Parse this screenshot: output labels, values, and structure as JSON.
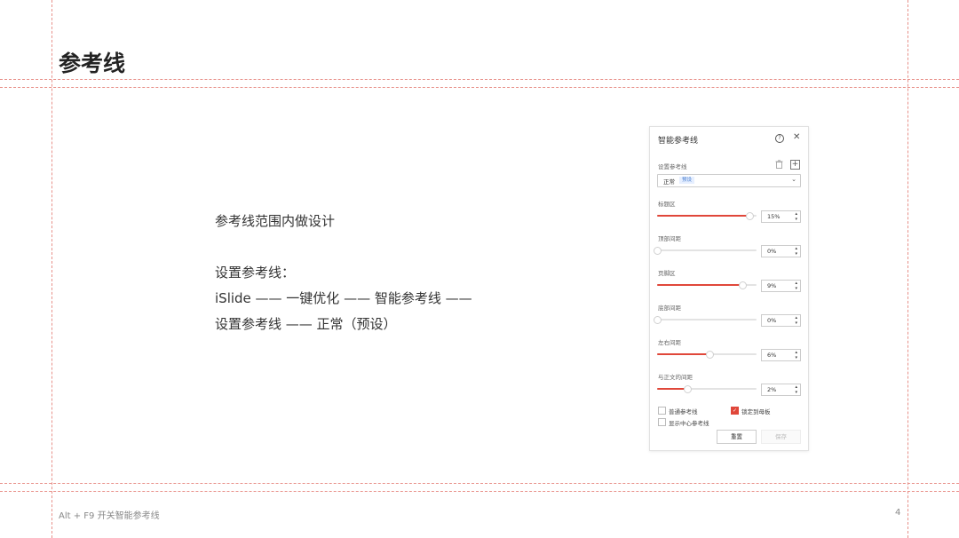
{
  "slide": {
    "title": "参考线",
    "body_lines": [
      "参考线范围内做设计",
      "设置参考线：",
      "iSlide —— 一键优化 —— 智能参考线 ——",
      "设置参考线 —— 正常（预设）"
    ],
    "footer": "Alt + F9 开关智能参考线",
    "page_number": "4"
  },
  "panel": {
    "title": "智能参考线",
    "help_icon": "help-circle-icon",
    "close_icon": "close-icon",
    "set_label": "设置参考线",
    "preset_value": "正常",
    "preset_badge": "预设",
    "accent_color": "#e0473a",
    "sliders": [
      {
        "label": "标题区",
        "value": "15%",
        "level": 0.93
      },
      {
        "label": "顶部间距",
        "value": "0%",
        "level": 0.0
      },
      {
        "label": "页脚区",
        "value": "9%",
        "level": 0.86
      },
      {
        "label": "底部间距",
        "value": "0%",
        "level": 0.0
      },
      {
        "label": "左右间距",
        "value": "6%",
        "level": 0.53
      },
      {
        "label": "与正文的间距",
        "value": "2%",
        "level": 0.3
      }
    ],
    "checkboxes": {
      "normal": {
        "label": "普通参考线",
        "checked": false
      },
      "lock": {
        "label": "锁定到母板",
        "checked": true
      },
      "center": {
        "label": "显示中心参考线",
        "checked": false
      }
    },
    "reset_label": "重置",
    "save_label": "保存"
  }
}
